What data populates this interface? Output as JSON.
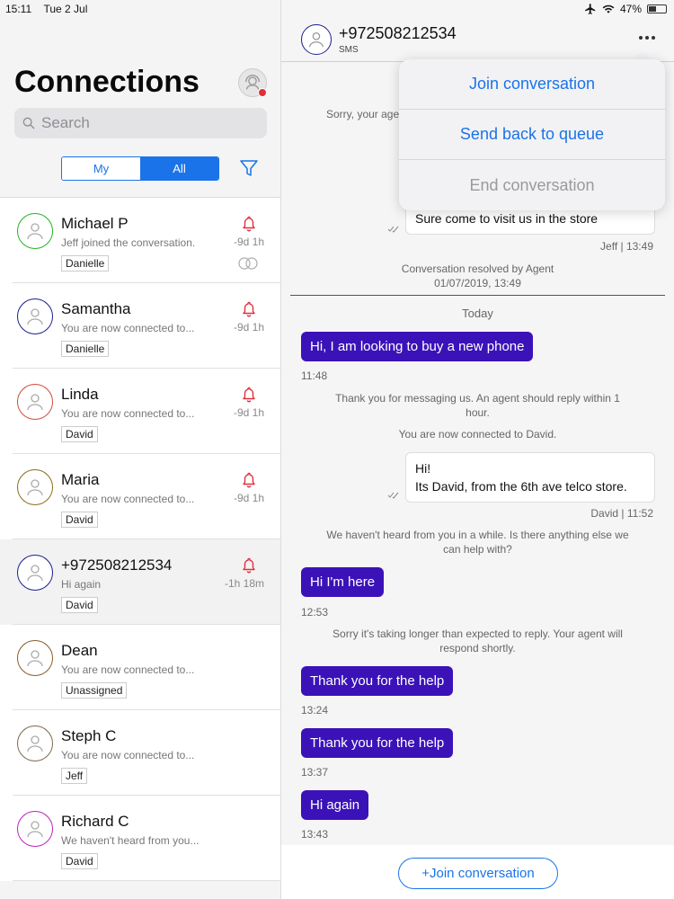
{
  "status_bar": {
    "time": "15:11",
    "date": "Tue 2 Jul",
    "battery": "47%",
    "battery_level": 0.47
  },
  "sidebar": {
    "title": "Connections",
    "search_placeholder": "Search",
    "segment": {
      "my": "My",
      "all": "All",
      "selected": "All"
    },
    "conversations": [
      {
        "name": "Michael P",
        "preview": "Jeff joined the conversation.",
        "agent": "Danielle",
        "time": "-9d 1h",
        "avatar_color": "#22b422",
        "has_bell": true,
        "has_rings": true
      },
      {
        "name": "Samantha",
        "preview": "You are now connected to...",
        "agent": "Danielle",
        "time": "-9d 1h",
        "avatar_color": "#1d1d8f",
        "has_bell": true
      },
      {
        "name": "Linda",
        "preview": "You are now connected to...",
        "agent": "David",
        "time": "-9d 1h",
        "avatar_color": "#d04a3a",
        "has_bell": true
      },
      {
        "name": "Maria",
        "preview": "You are now connected to...",
        "agent": "David",
        "time": "-9d 1h",
        "avatar_color": "#8a6d1a",
        "has_bell": true
      },
      {
        "name": "+972508212534",
        "preview": "Hi again",
        "agent": "David",
        "time": "-1h 18m",
        "avatar_color": "#1d1d8f",
        "has_bell": true,
        "selected": true
      },
      {
        "name": "Dean",
        "preview": "You are now connected to...",
        "agent": "Unassigned",
        "time": "",
        "avatar_color": "#8a5a2a",
        "has_bell": false
      },
      {
        "name": "Steph C",
        "preview": "You are now connected to...",
        "agent": "Jeff",
        "time": "",
        "avatar_color": "#7a6a4a",
        "has_bell": false
      },
      {
        "name": "Richard C",
        "preview": "We haven't heard from you...",
        "agent": "David",
        "time": "",
        "avatar_color": "#c020c0",
        "has_bell": false
      }
    ]
  },
  "chat": {
    "title": "+972508212534",
    "subtitle": "SMS",
    "menu": {
      "join": "Join conversation",
      "send_back": "Send back to queue",
      "end": "End conversation"
    },
    "history": {
      "sys_partial": "Sorry, your age",
      "agent_msg": "Sure come to visit us in the store",
      "agent_meta": "Jeff  |  13:49",
      "resolved": "Conversation resolved by Agent",
      "resolved_date": "01/07/2019, 13:49"
    },
    "today_label": "Today",
    "messages": {
      "m1": "Hi, I am looking to buy a new phone",
      "m1_time": "11:48",
      "sys1": "Thank you for messaging us. An agent should reply within 1 hour.",
      "sys2": "You are now connected to David.",
      "agent_line1": "Hi!",
      "agent_line2": "Its David, from the 6th ave telco store.",
      "agent_meta": "David  |  11:52",
      "sys3": "We haven't heard from you in a while. Is there anything else we can help with?",
      "m2": "Hi I'm here",
      "m2_time": "12:53",
      "sys4": "Sorry it's taking longer than expected to reply. Your agent will respond shortly.",
      "m3": "Thank you for the help",
      "m3_time": "13:24",
      "m4": "Thank you for the help",
      "m4_time": "13:37",
      "m5": "Hi again",
      "m5_time": "13:43"
    },
    "join_button": "+Join conversation"
  },
  "colors": {
    "accent": "#1a73e8",
    "incoming_bubble": "#3b12b8",
    "alert": "#e02f3a"
  }
}
